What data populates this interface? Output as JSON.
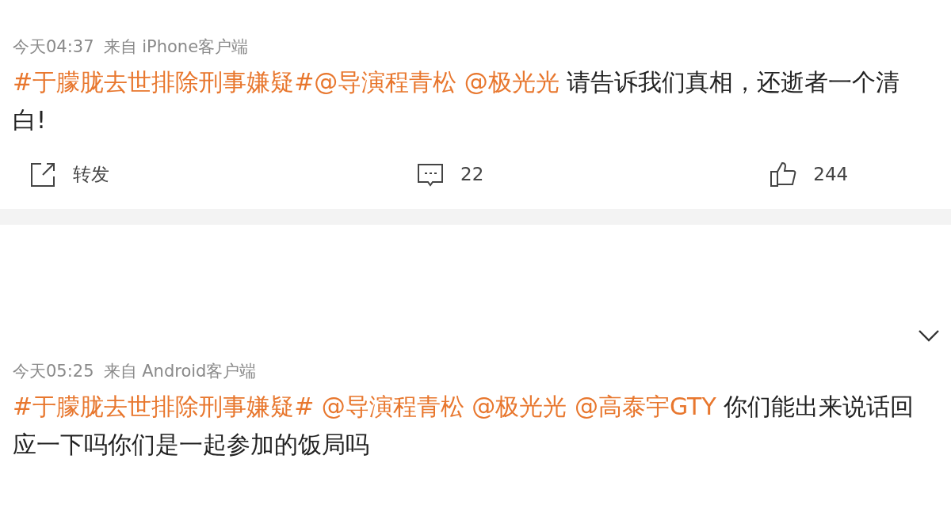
{
  "posts": [
    {
      "time": "今天04:37",
      "source": "来自 iPhone客户端",
      "segments": [
        {
          "kind": "hashtag",
          "text": "#于朦胧去世排除刑事嫌疑#"
        },
        {
          "kind": "mention",
          "text": "@导演程青松"
        },
        {
          "kind": "mention",
          "text": " @极光光"
        },
        {
          "kind": "text",
          "text": " 请告诉我们真相，还逝者一个清白!"
        }
      ],
      "actions": [
        {
          "kind": "repost",
          "label": "转发"
        },
        {
          "kind": "comment",
          "label": "22"
        },
        {
          "kind": "like",
          "label": "244"
        }
      ]
    },
    {
      "time": "今天05:25",
      "source": "来自 Android客户端",
      "segments": [
        {
          "kind": "hashtag",
          "text": "#于朦胧去世排除刑事嫌疑#"
        },
        {
          "kind": "mention",
          "text": " @导演程青松"
        },
        {
          "kind": "mention",
          "text": " @极光光"
        },
        {
          "kind": "mention",
          "text": " @高泰宇GTY"
        },
        {
          "kind": "text",
          "text": " 你们能出来说话回应一下吗你们是一起参加的饭局吗"
        }
      ]
    }
  ]
}
